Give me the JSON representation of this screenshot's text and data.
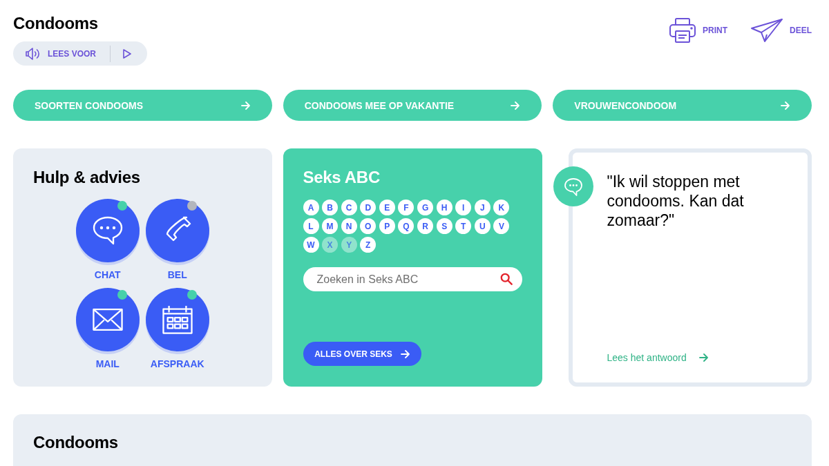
{
  "page": {
    "title": "Condooms"
  },
  "read_aloud": {
    "label": "LEES VOOR"
  },
  "actions": [
    {
      "label": "PRINT",
      "kind": "print"
    },
    {
      "label": "DEEL",
      "kind": "share"
    }
  ],
  "topic_links": [
    "SOORTEN CONDOOMS",
    "CONDOOMS MEE OP VAKANTIE",
    "VROUWENCONDOOM"
  ],
  "help": {
    "title": "Hulp & advies",
    "options": [
      {
        "label": "CHAT",
        "kind": "chat",
        "color": "#46d1aa"
      },
      {
        "label": "BEL",
        "kind": "phone",
        "color": "#b3b6bd"
      },
      {
        "label": "MAIL",
        "kind": "mail",
        "color": "#46d1aa"
      },
      {
        "label": "AFSPRAAK",
        "kind": "calendar",
        "color": "#46d1aa"
      }
    ]
  },
  "sex_abc": {
    "title": "Seks ABC",
    "letters": [
      {
        "letter": "A",
        "disabled": false
      },
      {
        "letter": "B",
        "disabled": false
      },
      {
        "letter": "C",
        "disabled": false
      },
      {
        "letter": "D",
        "disabled": false
      },
      {
        "letter": "E",
        "disabled": false
      },
      {
        "letter": "F",
        "disabled": false
      },
      {
        "letter": "G",
        "disabled": false
      },
      {
        "letter": "H",
        "disabled": false
      },
      {
        "letter": "I",
        "disabled": false
      },
      {
        "letter": "J",
        "disabled": false
      },
      {
        "letter": "K",
        "disabled": false
      },
      {
        "letter": "L",
        "disabled": false
      },
      {
        "letter": "M",
        "disabled": false
      },
      {
        "letter": "N",
        "disabled": false
      },
      {
        "letter": "O",
        "disabled": false
      },
      {
        "letter": "P",
        "disabled": false
      },
      {
        "letter": "Q",
        "disabled": false
      },
      {
        "letter": "R",
        "disabled": false
      },
      {
        "letter": "S",
        "disabled": false
      },
      {
        "letter": "T",
        "disabled": false
      },
      {
        "letter": "U",
        "disabled": false
      },
      {
        "letter": "V",
        "disabled": false
      },
      {
        "letter": "W",
        "disabled": false
      },
      {
        "letter": "X",
        "disabled": true
      },
      {
        "letter": "Y",
        "disabled": true
      },
      {
        "letter": "Z",
        "disabled": false
      }
    ],
    "search": {
      "placeholder": "Zoeken in Seks ABC"
    },
    "button": "ALLES OVER SEKS"
  },
  "question": {
    "text": "\"Ik wil stoppen met condooms. Kan dat zomaar?\"",
    "link": "Lees het antwoord"
  },
  "section": {
    "title": "Condooms"
  }
}
